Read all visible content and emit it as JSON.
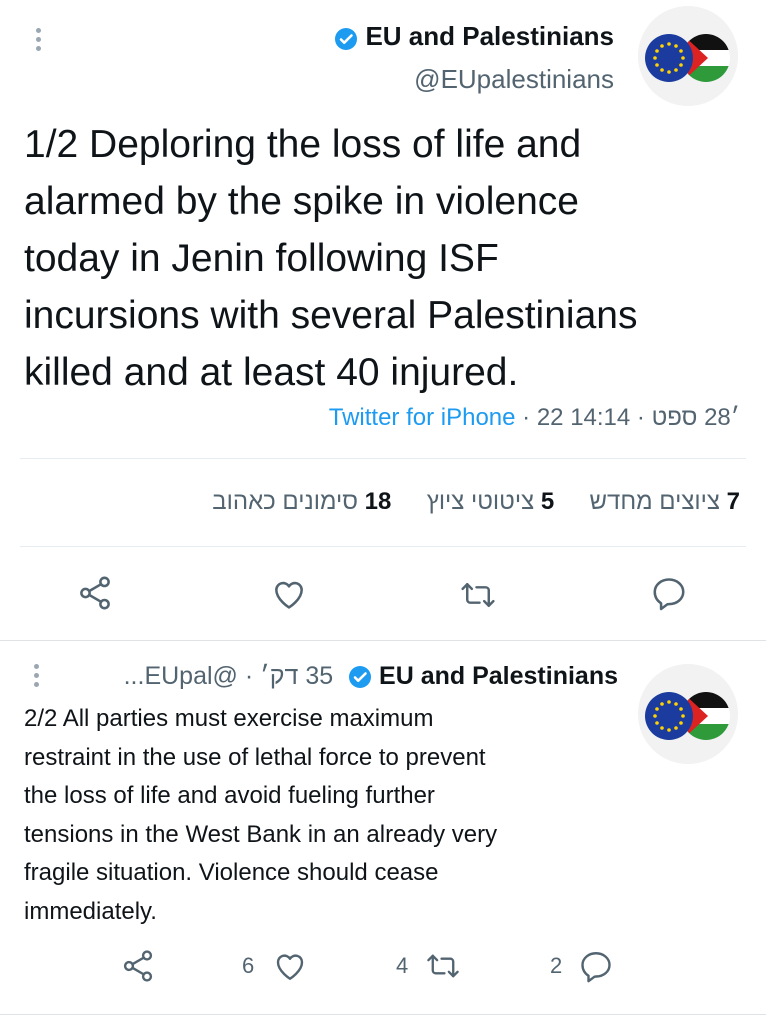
{
  "tweet1": {
    "display_name": "EU and Palestinians",
    "handle": "@EUpalestinians",
    "text": "1/2 Deploring the loss of life and alarmed by the spike in violence today in Jenin following ISF incursions with several Palestinians killed and at least 40 injured.",
    "text_lines": [
      "1/2 Deploring the loss of life and",
      "alarmed by the spike in violence",
      "today in Jenin following ISF",
      "incursions with several Palestinians",
      "killed and at least 40 injured."
    ],
    "source": "Twitter for iPhone",
    "meta": " · 22 ׳28 ספט · 14:14",
    "stats": [
      {
        "number": "7",
        "label": "ציוצים מחדש"
      },
      {
        "number": "5",
        "label": "ציטוטי ציוץ"
      },
      {
        "number": "18",
        "label": "סימונים כאהוב"
      }
    ]
  },
  "tweet2": {
    "display_name": "EU and Palestinians",
    "handle_time": "35 דק׳ · @EUpal...",
    "text_lines": [
      "2/2 All parties must exercise maximum",
      "restraint in the use of lethal force to prevent",
      "the loss of life and avoid fueling further",
      "tensions in the West Bank in an already very",
      "fragile situation. Violence should cease",
      "immediately."
    ],
    "likes": "6",
    "retweets": "4",
    "replies": "2"
  },
  "colors": {
    "brand_blue": "#1d9bf0",
    "icon_gray": "#536471",
    "text": "#0f1419"
  }
}
